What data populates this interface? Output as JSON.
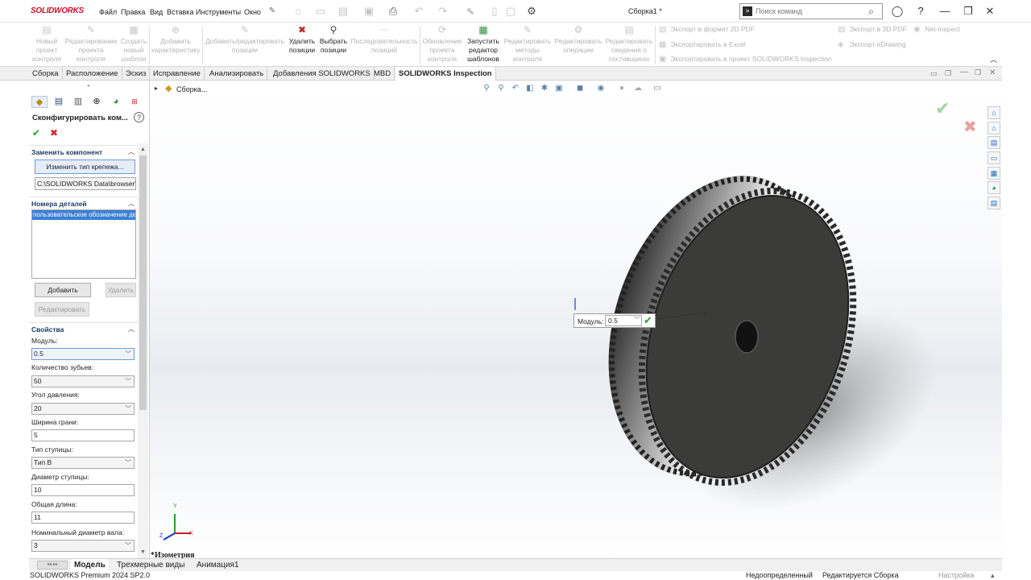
{
  "app": {
    "brand": "SOLIDWORKS",
    "document_title": "Сборка1 *",
    "search_placeholder": "Поиск команд"
  },
  "menu": [
    "Файл",
    "Правка",
    "Вид",
    "Вставка",
    "Инструменты",
    "Окно"
  ],
  "ribbon": {
    "buttons": [
      {
        "label": "Новый проект контроля",
        "enabled": false,
        "icon": "new-project-icon"
      },
      {
        "label": "Редактирование проекта контроля",
        "enabled": false,
        "icon": "edit-project-icon"
      },
      {
        "label": "Создать новый шаблон",
        "enabled": false,
        "icon": "new-template-icon"
      },
      {
        "label": "Добавить характеристику",
        "enabled": false,
        "icon": "add-characteristic-icon"
      },
      {
        "label": "Добавить/редактировать позиции",
        "enabled": false,
        "icon": "add-edit-balloons-icon"
      },
      {
        "label": "Удалить позиции",
        "enabled": true,
        "icon": "delete-balloons-icon"
      },
      {
        "label": "Выбрать позиции",
        "enabled": true,
        "icon": "select-balloons-icon"
      },
      {
        "label": "Последовательность позиций",
        "enabled": false,
        "icon": "balloon-sequence-icon"
      },
      {
        "label": "Обновление проекта контроля",
        "enabled": false,
        "icon": "update-project-icon"
      },
      {
        "label": "Запустить редактор шаблонов",
        "enabled": true,
        "icon": "template-editor-icon"
      },
      {
        "label": "Редактировать методы контроля",
        "enabled": false,
        "icon": "edit-methods-icon"
      },
      {
        "label": "Редактировать операции",
        "enabled": false,
        "icon": "edit-operations-icon"
      },
      {
        "label": "Редактировать сведения о поставщиках",
        "enabled": false,
        "icon": "edit-vendors-icon"
      }
    ],
    "exports": [
      "Экспорт в формат 2D PDF",
      "Экспортировать в Excel",
      "Экспортировать в проект SOLIDWORKS Inspection",
      "Экспорт в 3D PDF",
      "Экспорт eDrawing",
      "Net-Inspect"
    ]
  },
  "command_tabs": [
    "Сборка",
    "Расположение",
    "Эскиз",
    "Исправление",
    "Анализировать",
    "Добавления SOLIDWORKS",
    "MBD",
    "SOLIDWORKS Inspection"
  ],
  "active_command_tab": "SOLIDWORKS Inspection",
  "property_manager": {
    "title": "Сконфигурировать ком...",
    "replace_section": {
      "title": "Заменить компонент",
      "change_button": "Изменить тип крепежа...",
      "path": "C:\\SOLIDWORKS Data\\browser\\IS"
    },
    "part_numbers": {
      "title": "Номера деталей",
      "selected_item": "пользовательское обозначение детали",
      "add": "Добавить",
      "delete": "Удалить",
      "edit": "Редактировать"
    },
    "properties": {
      "title": "Свойства",
      "fields": [
        {
          "label": "Модуль:",
          "value": "0.5",
          "type": "select"
        },
        {
          "label": "Количество зубьев:",
          "value": "50",
          "type": "select"
        },
        {
          "label": "Угол давления:",
          "value": "20",
          "type": "select"
        },
        {
          "label": "Ширина грани:",
          "value": "5",
          "type": "input"
        },
        {
          "label": "Тип ступицы:",
          "value": "Тип В",
          "type": "select"
        },
        {
          "label": "Диаметр ступицы:",
          "value": "10",
          "type": "input"
        },
        {
          "label": "Общая длина:",
          "value": "11",
          "type": "input"
        },
        {
          "label": "Номинальный диаметр вала:",
          "value": "3",
          "type": "select"
        }
      ]
    }
  },
  "viewport": {
    "tree_root": "Сборка...",
    "view_name": "*Изометрия",
    "callout_label": "Модуль:",
    "callout_value": "0.5",
    "triad": {
      "x": "X",
      "y": "Y",
      "z": "Z"
    }
  },
  "bottom_tabs": [
    "Модель",
    "Трехмерные виды",
    "Анимация1"
  ],
  "status_bar": {
    "product": "SOLIDWORKS Premium 2024 SP2.0",
    "state": "Недоопределенный",
    "mode": "Редактируется Сборка",
    "custom": "Настройка"
  },
  "colors": {
    "brand_red": "#c8102e",
    "section_heading": "#1c3b68",
    "selection_blue": "#3a7fd5",
    "confirm_green": "#2aa02a",
    "cancel_red": "#d12a2a"
  }
}
